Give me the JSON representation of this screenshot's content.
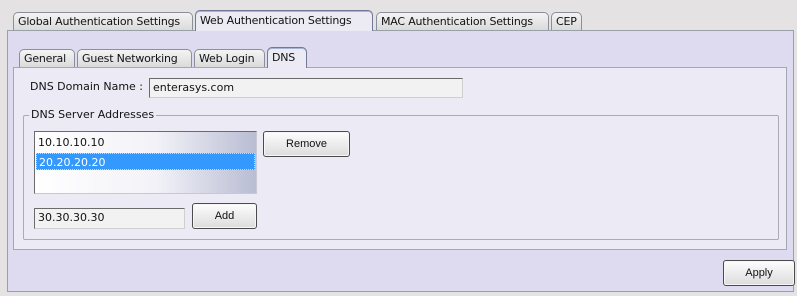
{
  "top_tabs": [
    {
      "label": "Global Authentication Settings",
      "selected": false
    },
    {
      "label": "Web Authentication Settings",
      "selected": true
    },
    {
      "label": "MAC Authentication Settings",
      "selected": false
    },
    {
      "label": "CEP",
      "selected": false
    }
  ],
  "sub_tabs": [
    {
      "label": "General",
      "selected": false
    },
    {
      "label": "Guest Networking",
      "selected": false
    },
    {
      "label": "Web Login",
      "selected": false
    },
    {
      "label": "DNS",
      "selected": true
    }
  ],
  "dns": {
    "domain_label": "DNS Domain Name :",
    "domain_value": "enterasys.com",
    "servers_group_title": "DNS Server Addresses",
    "servers": [
      {
        "address": "10.10.10.10",
        "selected": false
      },
      {
        "address": "20.20.20.20",
        "selected": true
      }
    ],
    "new_address_value": "30.30.30.30",
    "remove_label": "Remove",
    "add_label": "Add"
  },
  "footer": {
    "apply_label": "Apply"
  }
}
